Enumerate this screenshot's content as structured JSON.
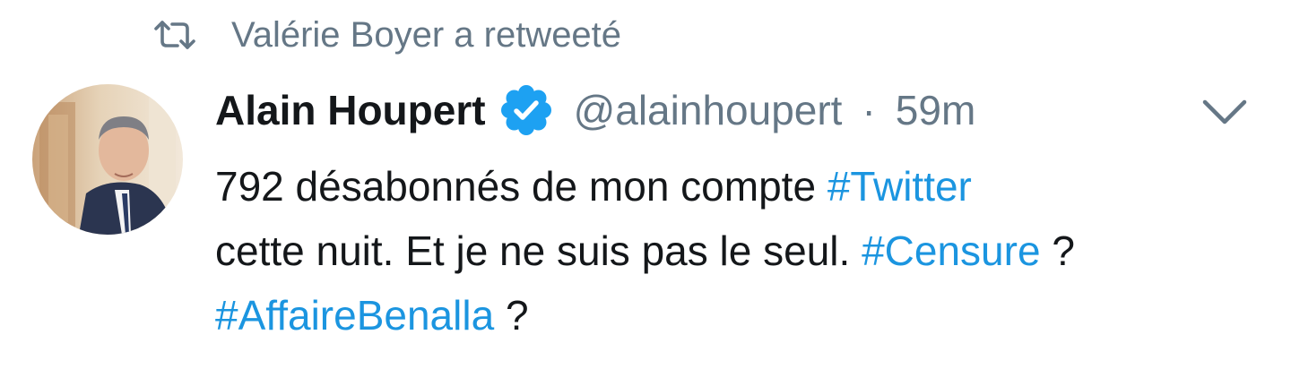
{
  "retweet": {
    "icon": "retweet-icon",
    "label": "Valérie Boyer a retweeté"
  },
  "author": {
    "avatar": "avatar-photo",
    "display_name": "Alain Houpert",
    "verified_icon": "verified-badge-icon",
    "handle": "@alainhoupert",
    "separator": "·",
    "time": "59m"
  },
  "menu": {
    "icon": "chevron-down-icon"
  },
  "tweet": {
    "line1": {
      "text": "792 désabonnés de mon compte",
      "hashtag": "#Twitter"
    },
    "line2": {
      "text": "cette nuit. Et je ne suis pas le seul.",
      "hashtag": "#Censure",
      "suffix": "?"
    },
    "line3": {
      "hashtag": "#AffaireBenalla",
      "suffix": "?"
    }
  },
  "colors": {
    "text": "#14171a",
    "secondary": "#657786",
    "link": "#1b95e0",
    "verified": "#1da1f2"
  }
}
